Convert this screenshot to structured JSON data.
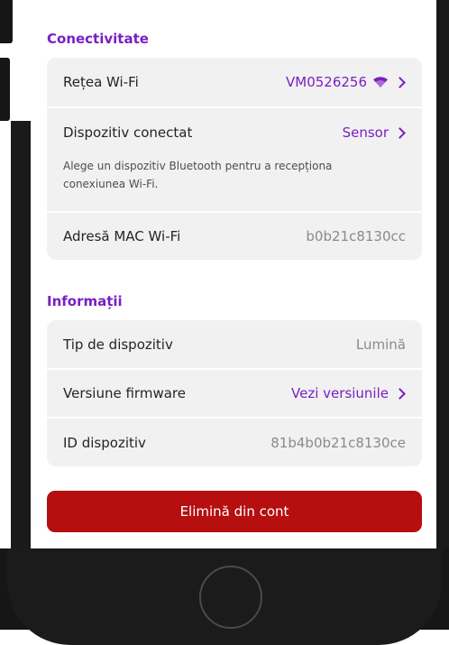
{
  "connectivity": {
    "title": "Conectivitate",
    "wifi_label": "Rețea Wi-Fi",
    "wifi_value": "VM0526256",
    "device_label": "Dispozitiv conectat",
    "device_value": "Sensor",
    "device_helper": "Alege un dispozitiv Bluetooth pentru a recepționa conexiunea Wi-Fi.",
    "mac_label": "Adresă MAC Wi-Fi",
    "mac_value": "b0b21c8130cc"
  },
  "info": {
    "title": "Informații",
    "type_label": "Tip de dispozitiv",
    "type_value": "Lumină",
    "firmware_label": "Versiune firmware",
    "firmware_value": "Vezi versiunile",
    "id_label": "ID dispozitiv",
    "id_value": "81b4b0b21c8130ce"
  },
  "actions": {
    "remove_label": "Elimină din cont"
  },
  "colors": {
    "accent": "#7a1fc1",
    "danger": "#b50f0f",
    "card": "#f1f1f1"
  },
  "icons": {
    "wifi": "wifi-icon",
    "chevron": "chevron-right-icon"
  }
}
